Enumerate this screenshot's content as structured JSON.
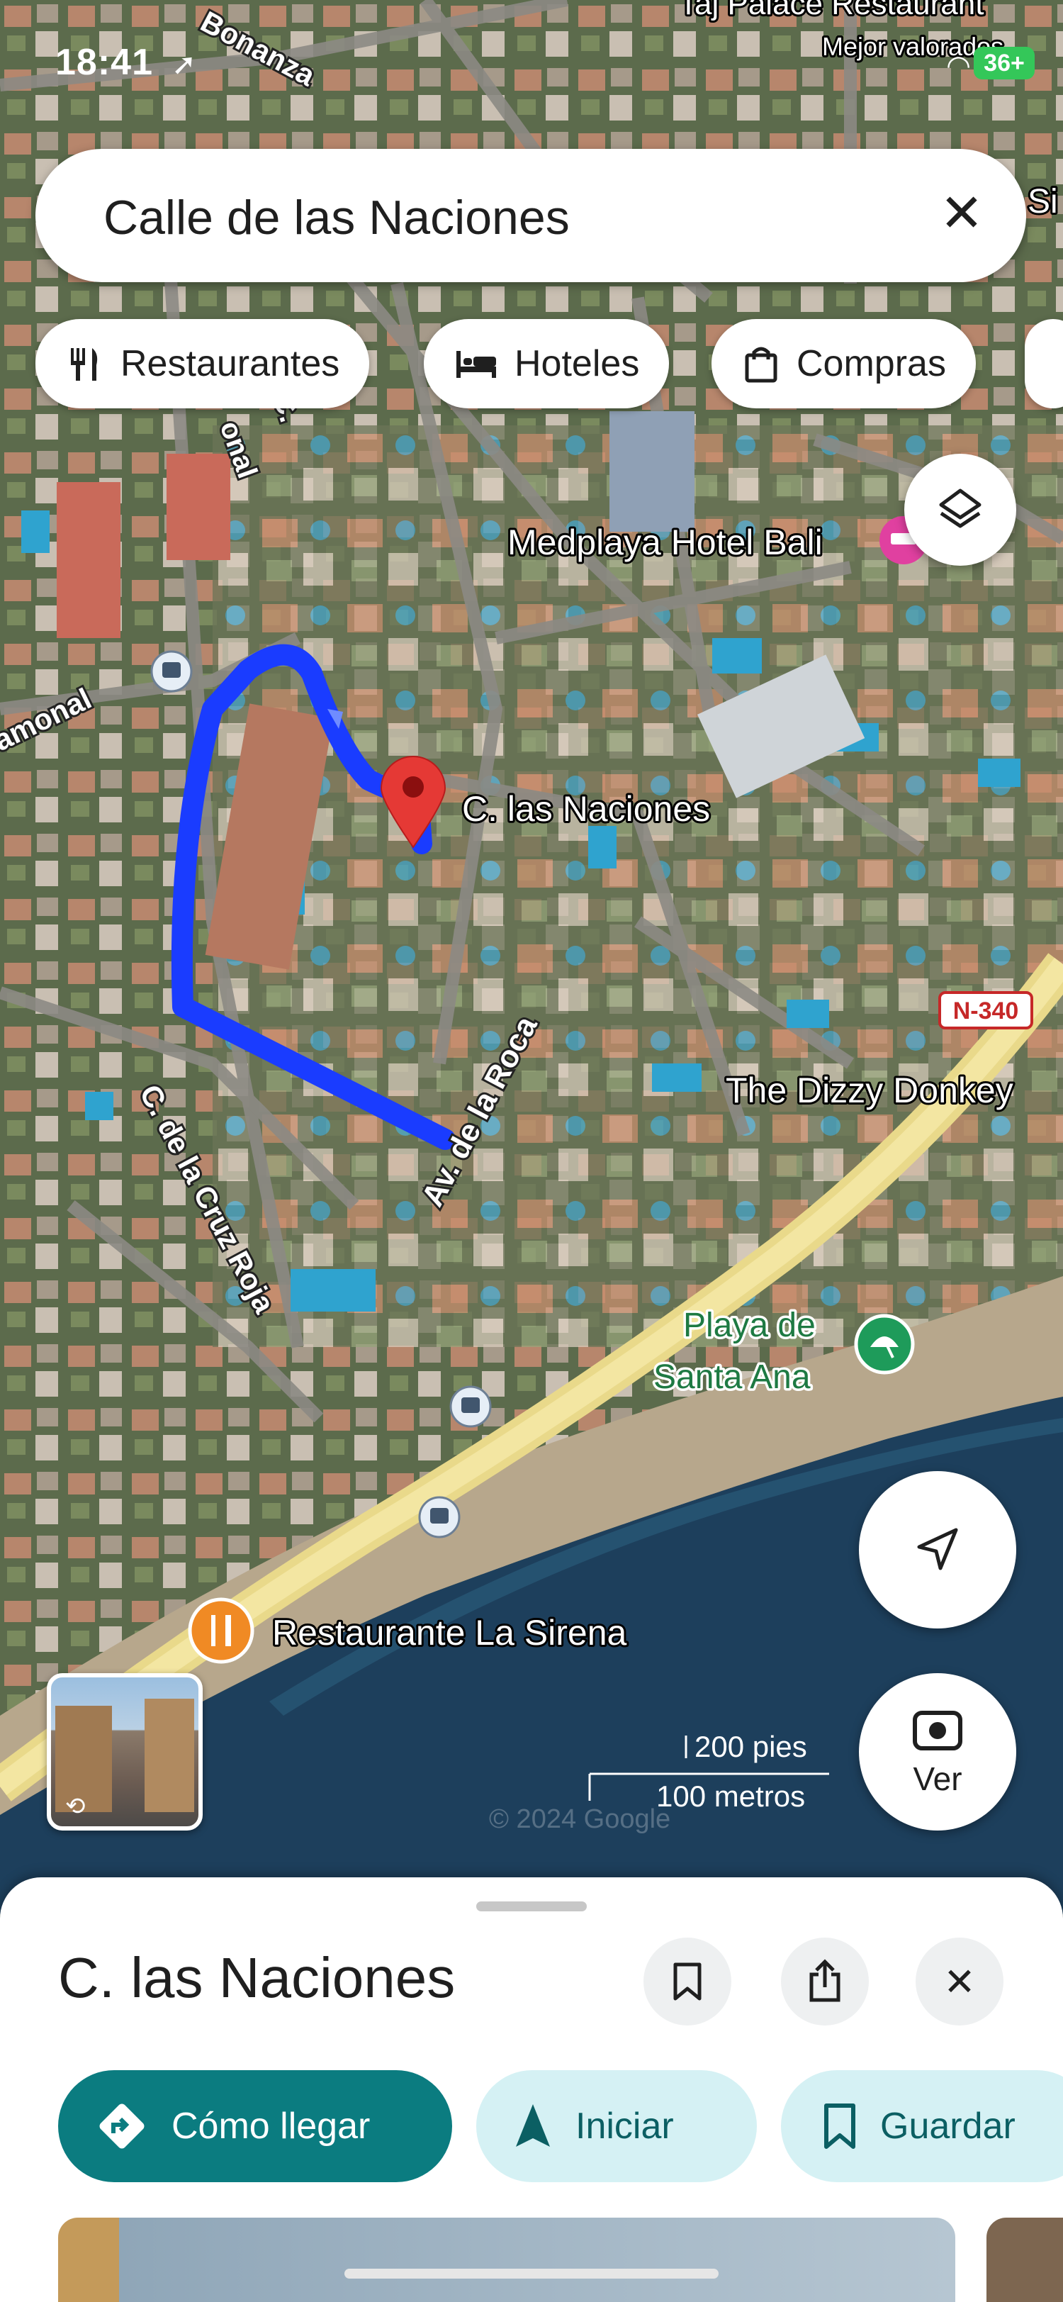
{
  "status": {
    "time": "18:41",
    "battery": "36+"
  },
  "search": {
    "query": "Calle de las Naciones"
  },
  "chips": [
    {
      "label": "Restaurantes",
      "icon": "fork-knife-icon"
    },
    {
      "label": "Hoteles",
      "icon": "bed-icon"
    },
    {
      "label": "Compras",
      "icon": "shopping-bag-icon"
    }
  ],
  "map": {
    "labels": {
      "top_bonanza": "Bonanza",
      "top_restaurant": "Taj Palace Restaurant",
      "top_restaurant_sub": "Mejor valorados",
      "top_right_cut": "Si",
      "road_ramonal": "amonal",
      "road_nal": "onal",
      "road_c": "C.",
      "hotel": "Medplaya Hotel Bali",
      "destination": "C. las Naciones",
      "n340": "N-340",
      "dizzy": "The Dizzy Donkey",
      "av_roca": "Av. de la Roca",
      "cruz_roja": "C. de la Cruz Roja",
      "beach_1": "Playa de",
      "beach_2": "Santa Ana",
      "restaurant_sirena": "Restaurante La Sirena",
      "scale_ft": "200 pies",
      "scale_m": "100 metros",
      "copyright": "© 2024 Google"
    },
    "route_color": "#1a3cff",
    "pin_color": "#e53935"
  },
  "buttons": {
    "ver_label": "Ver"
  },
  "sheet": {
    "title": "C. las Naciones",
    "actions": [
      {
        "label": "Cómo llegar",
        "icon": "directions-icon"
      },
      {
        "label": "Iniciar",
        "icon": "navigation-arrow-icon"
      },
      {
        "label": "Guardar",
        "icon": "bookmark-icon"
      }
    ]
  }
}
